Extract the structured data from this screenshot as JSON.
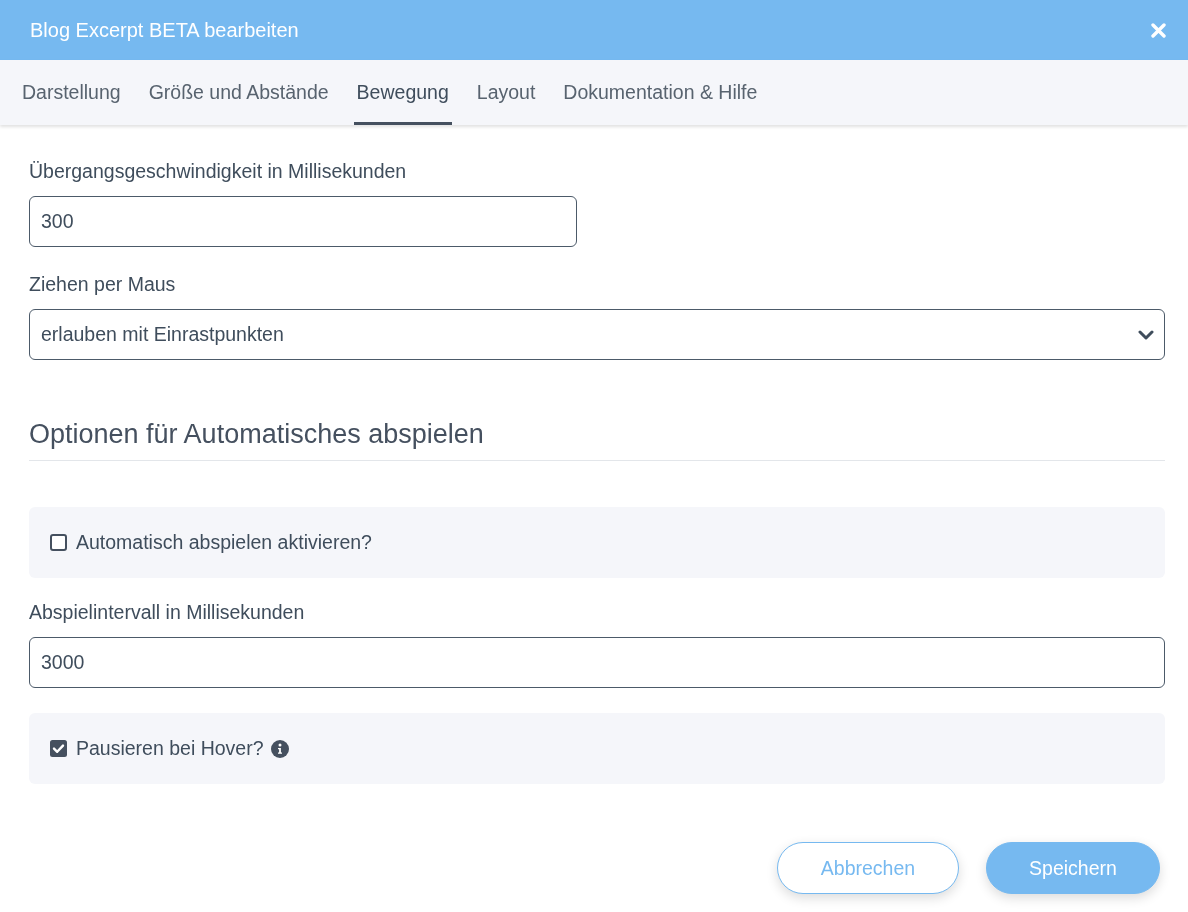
{
  "dialog": {
    "title": "Blog Excerpt BETA bearbeiten"
  },
  "tabs": [
    {
      "label": "Darstellung",
      "selected": false
    },
    {
      "label": "Größe und Abstände",
      "selected": false
    },
    {
      "label": "Bewegung",
      "selected": true
    },
    {
      "label": "Layout",
      "selected": false
    },
    {
      "label": "Dokumentation & Hilfe",
      "selected": false
    }
  ],
  "form": [
    {
      "kind": "text_input",
      "label": "Übergangsgeschwindigkeit in Millisekunden",
      "value": "300"
    },
    {
      "kind": "select",
      "label": "Ziehen per Maus",
      "value": "erlauben mit Einrastpunkten"
    },
    {
      "kind": "heading",
      "text": "Optionen für Automatisches abspielen"
    },
    {
      "kind": "checkbox",
      "label": "Automatisch abspielen aktivieren?",
      "checked": false,
      "info": false
    },
    {
      "kind": "text_input",
      "label": "Abspielintervall in Millisekunden",
      "value": "3000"
    },
    {
      "kind": "checkbox",
      "label": "Pausieren bei Hover?",
      "checked": true,
      "info": true
    }
  ],
  "buttons": [
    {
      "kind": "secondary",
      "label": "Abbrechen"
    },
    {
      "kind": "primary",
      "label": "Speichern"
    }
  ]
}
